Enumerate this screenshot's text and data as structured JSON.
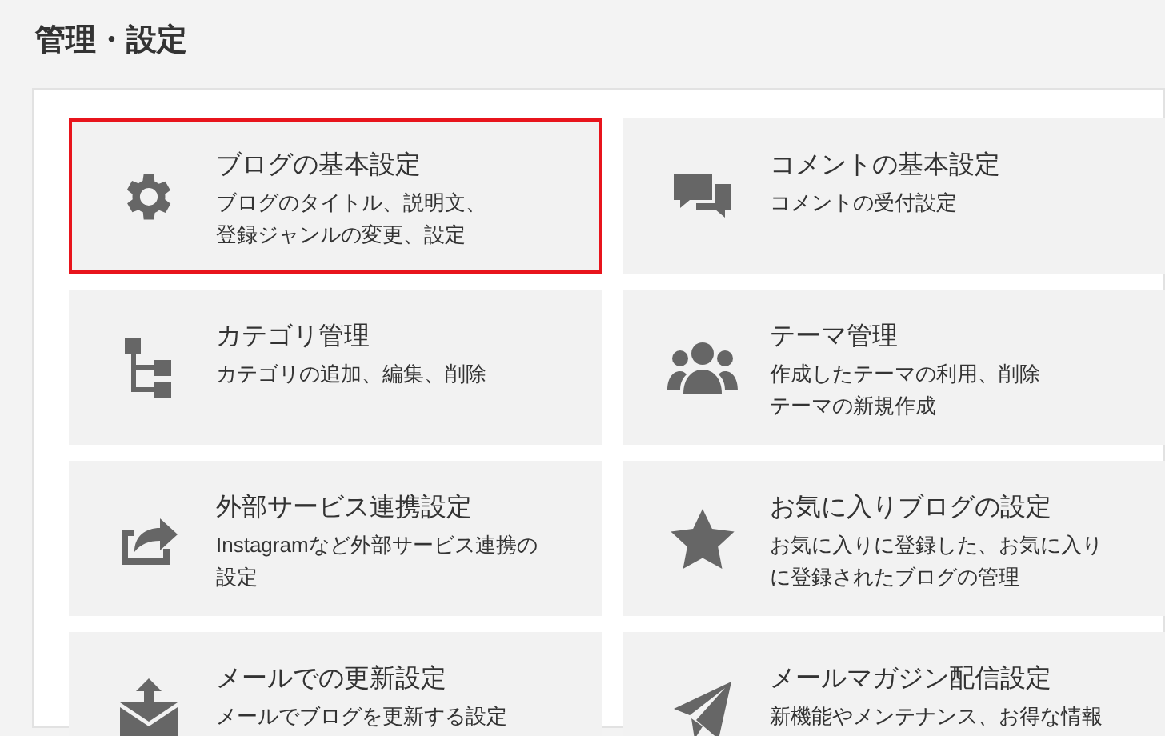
{
  "header": {
    "title": "管理・設定"
  },
  "cards": [
    {
      "kind": "gear",
      "title": "ブログの基本設定",
      "description": [
        "ブログのタイトル、説明文、",
        "登録ジャンルの変更、設定"
      ],
      "selected": true
    },
    {
      "kind": "chat",
      "title": "コメントの基本設定",
      "description": [
        "コメントの受付設定"
      ],
      "selected": false
    },
    {
      "kind": "tree",
      "title": "カテゴリ管理",
      "description": [
        "カテゴリの追加、編集、削除"
      ],
      "selected": false
    },
    {
      "kind": "people",
      "title": "テーマ管理",
      "description": [
        "作成したテーマの利用、削除",
        "テーマの新規作成"
      ],
      "selected": false
    },
    {
      "kind": "share",
      "title": "外部サービス連携設定",
      "description": [
        "Instagramなど外部サービス連携の",
        "設定"
      ],
      "selected": false
    },
    {
      "kind": "star",
      "title": "お気に入りブログの設定",
      "description": [
        "お気に入りに登録した、お気に入り",
        "に登録されたブログの管理"
      ],
      "selected": false
    },
    {
      "kind": "mail",
      "title": "メールでの更新設定",
      "description": [
        "メールでブログを更新する設定"
      ],
      "selected": false
    },
    {
      "kind": "plane",
      "title": "メールマガジン配信設定",
      "description": [
        "新機能やメンテナンス、お得な情報"
      ],
      "selected": false
    }
  ]
}
